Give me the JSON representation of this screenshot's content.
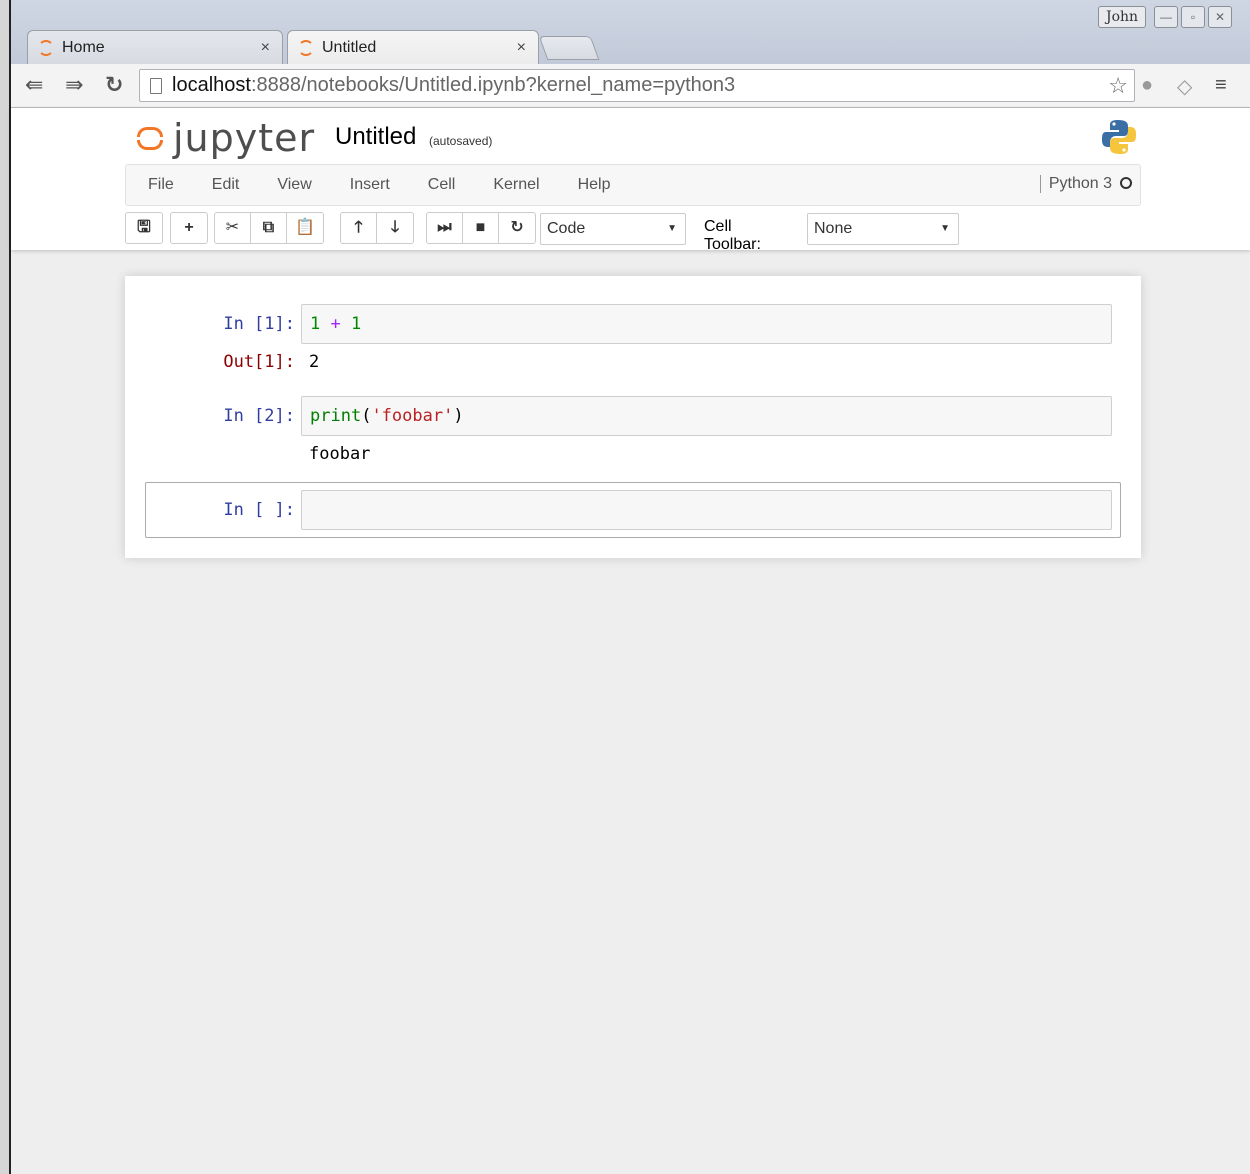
{
  "browser": {
    "tabs": [
      {
        "label": "Home",
        "close": "×"
      },
      {
        "label": "Untitled",
        "close": "×"
      }
    ],
    "user": "John",
    "url_host": "localhost",
    "url_rest": ":8888/notebooks/Untitled.ipynb?kernel_name=python3"
  },
  "header": {
    "logo_text": "jupyter",
    "notebook_title": "Untitled",
    "autosave_status": "(autosaved)"
  },
  "menu": {
    "items": [
      "File",
      "Edit",
      "View",
      "Insert",
      "Cell",
      "Kernel",
      "Help"
    ],
    "kernel_name": "Python 3"
  },
  "toolbar": {
    "cell_type": "Code",
    "cell_toolbar_label": "Cell Toolbar:",
    "cell_toolbar_value": "None"
  },
  "cells": [
    {
      "prompt": "In [1]:",
      "code": {
        "a": "1",
        "op": "+",
        "b": "1"
      },
      "out_prompt": "Out[1]:",
      "output": "2"
    },
    {
      "prompt": "In [2]:",
      "code": {
        "fn": "print",
        "open": "(",
        "str": "'foobar'",
        "close": ")"
      },
      "output": "foobar"
    },
    {
      "prompt": "In [ ]:",
      "code": ""
    }
  ],
  "colors": {
    "jupyter_orange": "#f37626",
    "prompt_in": "#303f9f",
    "prompt_out": "#8b0000"
  }
}
